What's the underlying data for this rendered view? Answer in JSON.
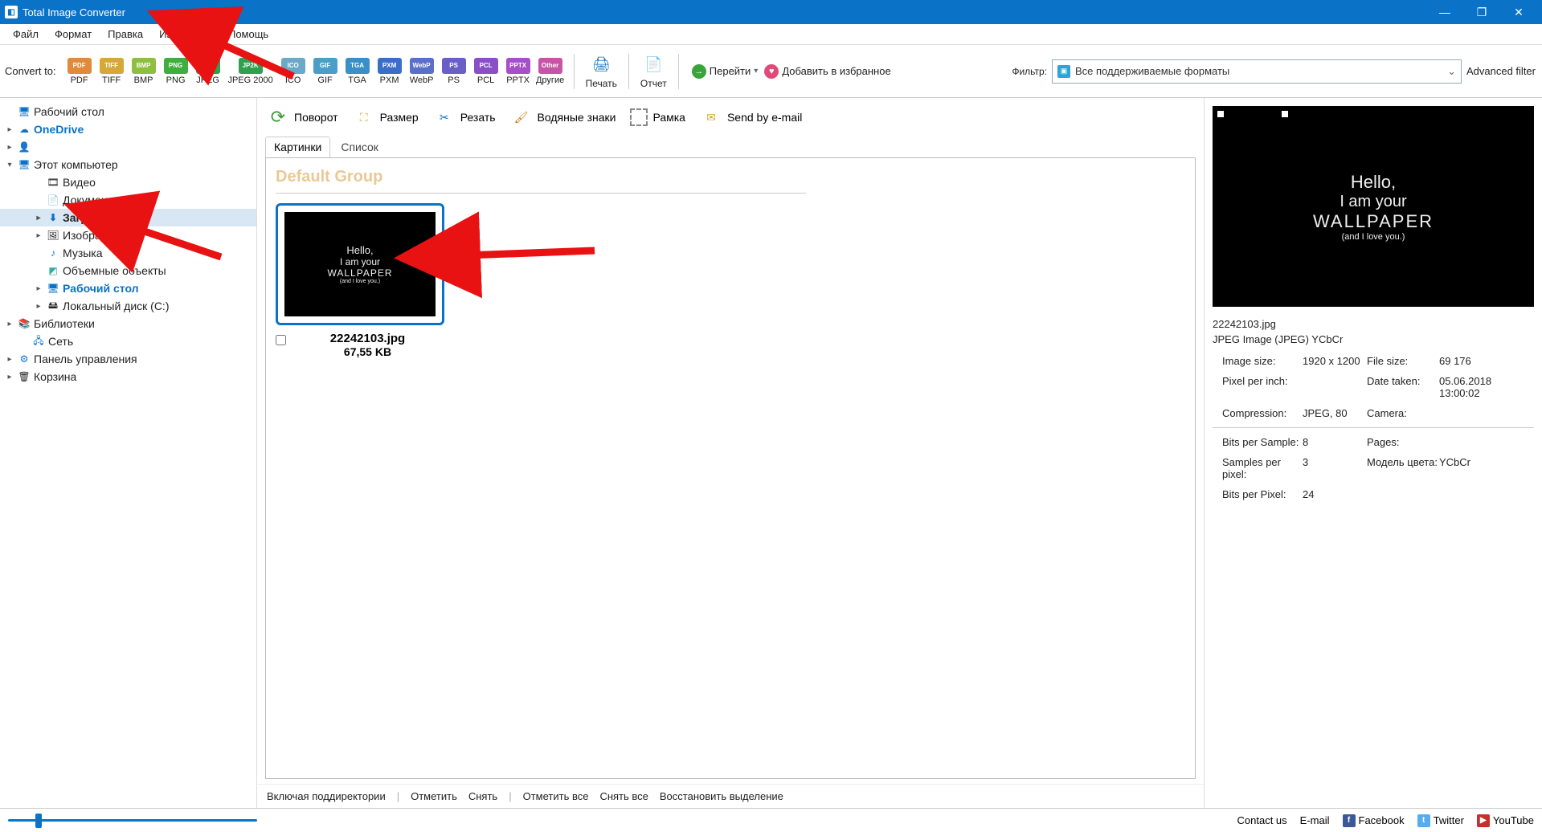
{
  "title": "Total Image Converter",
  "menu": [
    "Файл",
    "Формат",
    "Правка",
    "Избранное",
    "Помощь"
  ],
  "convert_label": "Convert to:",
  "formats": [
    {
      "label": "PDF",
      "color": "#e08a3a"
    },
    {
      "label": "TIFF",
      "color": "#d6a837"
    },
    {
      "label": "BMP",
      "color": "#8fbf3f"
    },
    {
      "label": "PNG",
      "color": "#3fae3f"
    },
    {
      "label": "JPEG",
      "color": "#2fa04f"
    },
    {
      "label": "JPEG 2000",
      "color": "#2fa04f",
      "short": "JP2K"
    },
    {
      "label": "ICO",
      "color": "#6aa9c7"
    },
    {
      "label": "GIF",
      "color": "#4a9ec7"
    },
    {
      "label": "TGA",
      "color": "#3a8fc7"
    },
    {
      "label": "PXM",
      "color": "#3a6fc7"
    },
    {
      "label": "WebP",
      "color": "#5a6fc7"
    },
    {
      "label": "PS",
      "color": "#6a5fc7"
    },
    {
      "label": "PCL",
      "color": "#8a4fc7"
    },
    {
      "label": "PPTX",
      "color": "#a74fc7"
    }
  ],
  "other_label": "Другие",
  "print_label": "Печать",
  "report_label": "Отчет",
  "goto_label": "Перейти",
  "fav_label": "Добавить в избранное",
  "filter_label": "Фильтр:",
  "filter_value": "Все поддерживаемые форматы",
  "advanced_label": "Advanced filter",
  "tree": {
    "desktop": "Рабочий стол",
    "onedrive": "OneDrive",
    "user": "",
    "thispc": "Этот компьютер",
    "video": "Видео",
    "documents": "Документы",
    "downloads": "Загрузки",
    "pictures": "Изображения",
    "music": "Музыка",
    "objects3d": "Объемные объекты",
    "desktop2": "Рабочий стол",
    "localdisk": "Локальный диск (C:)",
    "libraries": "Библиотеки",
    "network": "Сеть",
    "controlpanel": "Панель управления",
    "recycle": "Корзина"
  },
  "actions": {
    "rotate": "Поворот",
    "resize": "Размер",
    "crop": "Резать",
    "watermark": "Водяные знаки",
    "frame": "Рамка",
    "email": "Send by e-mail"
  },
  "tabs": {
    "images": "Картинки",
    "list": "Список"
  },
  "group": "Default Group",
  "thumb": {
    "filename": "22242103.jpg",
    "filesize": "67,55 KB",
    "lines": [
      "Hello,",
      "I am your",
      "WALLPAPER",
      "(and I love you.)"
    ]
  },
  "bottom": {
    "include": "Включая поддиректории",
    "check": "Отметить",
    "uncheck": "Снять",
    "checkall": "Отметить все",
    "uncheckall": "Снять все",
    "restore": "Восстановить выделение"
  },
  "preview": {
    "filename": "22242103.jpg",
    "type": "JPEG Image (JPEG) YCbCr",
    "rows": [
      [
        "Image size:",
        "1920 x 1200",
        "File size:",
        "69 176"
      ],
      [
        "Pixel per inch:",
        "",
        "Date taken:",
        "05.06.2018 13:00:02"
      ],
      [
        "Compression:",
        "JPEG, 80",
        "Camera:",
        ""
      ]
    ],
    "rows2": [
      [
        "Bits per Sample:",
        "8",
        "Pages:",
        ""
      ],
      [
        "Samples per pixel:",
        "3",
        "Модель цвета:",
        "YCbCr"
      ],
      [
        "Bits per Pixel:",
        "24",
        "",
        ""
      ]
    ]
  },
  "footer": {
    "contact": "Contact us",
    "email": "E-mail",
    "facebook": "Facebook",
    "twitter": "Twitter",
    "youtube": "YouTube"
  }
}
